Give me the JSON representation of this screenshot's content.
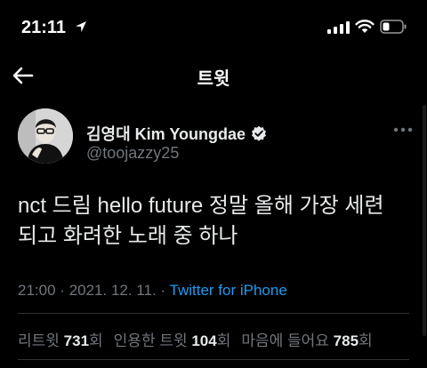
{
  "status_bar": {
    "time": "21:11",
    "icons": [
      "location-arrow-icon",
      "cellular-signal-icon",
      "wifi-icon",
      "battery-icon"
    ]
  },
  "nav": {
    "title": "트윗",
    "back_icon": "back-arrow-icon"
  },
  "tweet": {
    "display_name": "김영대 Kim Youngdae",
    "handle": "@toojazzy25",
    "verified": true,
    "text": "nct 드림 hello future 정말 올해 가장 세련\n되고 화려한 노래 중 하나",
    "time": "21:00",
    "date": "2021. 12. 11.",
    "separator": "·",
    "source": "Twitter for iPhone",
    "stats": {
      "retweets_label": "리트윗",
      "retweets_count": "731",
      "retweets_suffix": "회",
      "quotes_label": "인용한 트윗",
      "quotes_count": "104",
      "quotes_suffix": "회",
      "likes_label": "마음에 들어요",
      "likes_count": "785",
      "likes_suffix": "회"
    }
  },
  "colors": {
    "background": "#000000",
    "text": "#e7e9ea",
    "secondary_text": "#71767b",
    "accent": "#1d9bf0",
    "divider": "#2f3336"
  }
}
